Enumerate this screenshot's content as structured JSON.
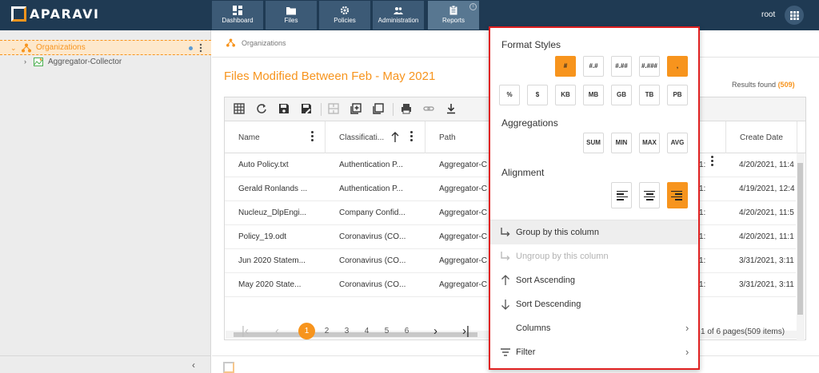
{
  "app": {
    "brand": "APARAVI",
    "user": "root"
  },
  "nav": {
    "tabs": [
      {
        "label": "Dashboard",
        "icon": "dashboard-icon"
      },
      {
        "label": "Files",
        "icon": "folder-icon"
      },
      {
        "label": "Policies",
        "icon": "gear-icon"
      },
      {
        "label": "Administration",
        "icon": "users-icon"
      },
      {
        "label": "Reports",
        "icon": "clipboard-icon",
        "active": true
      }
    ],
    "info_glyph": "i"
  },
  "sidebar": {
    "root_label": "Organizations",
    "child_label": "Aggregator-Collector",
    "collapse_glyph": "‹"
  },
  "breadcrumb": "Organizations",
  "report": {
    "title": "Files Modified Between Feb - May 2021",
    "results_label": "Results found",
    "results_count": "(509)"
  },
  "table": {
    "columns": [
      "Name",
      "Classificati...",
      "Path",
      "Create Date"
    ],
    "rows": [
      {
        "name": "Auto Policy.txt",
        "classification": "Authentication P...",
        "path": "Aggregator-C",
        "date": "4/20/2021, 11:4"
      },
      {
        "name": "Gerald Ronlands ...",
        "classification": "Authentication P...",
        "path": "Aggregator-C",
        "date": "4/19/2021, 12:4"
      },
      {
        "name": "Nucleuz_DlpEngi...",
        "classification": "Company Confid...",
        "path": "Aggregator-C",
        "date": "4/20/2021, 11:5"
      },
      {
        "name": "Policy_19.odt",
        "classification": "Coronavirus (CO...",
        "path": "Aggregator-C",
        "date": "4/20/2021, 11:1"
      },
      {
        "name": "Jun 2020 Statem...",
        "classification": "Coronavirus (CO...",
        "path": "Aggregator-C",
        "date": "3/31/2021, 3:11"
      },
      {
        "name": "May 2020 State...",
        "classification": "Coronavirus (CO...",
        "path": "Aggregator-C",
        "date": "3/31/2021, 3:11"
      }
    ],
    "row_fragment": "1:"
  },
  "pager": {
    "pages": [
      "1",
      "2",
      "3",
      "4",
      "5",
      "6"
    ],
    "current": "1",
    "info": "1 of 6 pages(509 items)",
    "first_glyph": "|‹",
    "prev_glyph": "‹",
    "next_glyph": "›",
    "last_glyph": "›|"
  },
  "column_menu": {
    "format_styles_label": "Format Styles",
    "format_row1": [
      "#",
      "#.#",
      "#.##",
      "#.###",
      ","
    ],
    "format_row2": [
      "%",
      "$",
      "KB",
      "MB",
      "GB",
      "TB",
      "PB"
    ],
    "aggregations_label": "Aggregations",
    "aggregations": [
      "SUM",
      "MIN",
      "MAX",
      "AVG"
    ],
    "alignment_label": "Alignment",
    "items": [
      {
        "label": "Group by this column",
        "icon": "group-icon",
        "state": "hover"
      },
      {
        "label": "Ungroup by this column",
        "icon": "ungroup-icon",
        "state": "disabled"
      },
      {
        "label": "Sort Ascending",
        "icon": "arrow-up-icon"
      },
      {
        "label": "Sort Descending",
        "icon": "arrow-down-icon"
      },
      {
        "label": "Columns",
        "icon": "",
        "submenu": true
      },
      {
        "label": "Filter",
        "icon": "filter-icon",
        "submenu": true
      }
    ],
    "accent": "#f7941d",
    "highlight_border": "#e02020"
  }
}
